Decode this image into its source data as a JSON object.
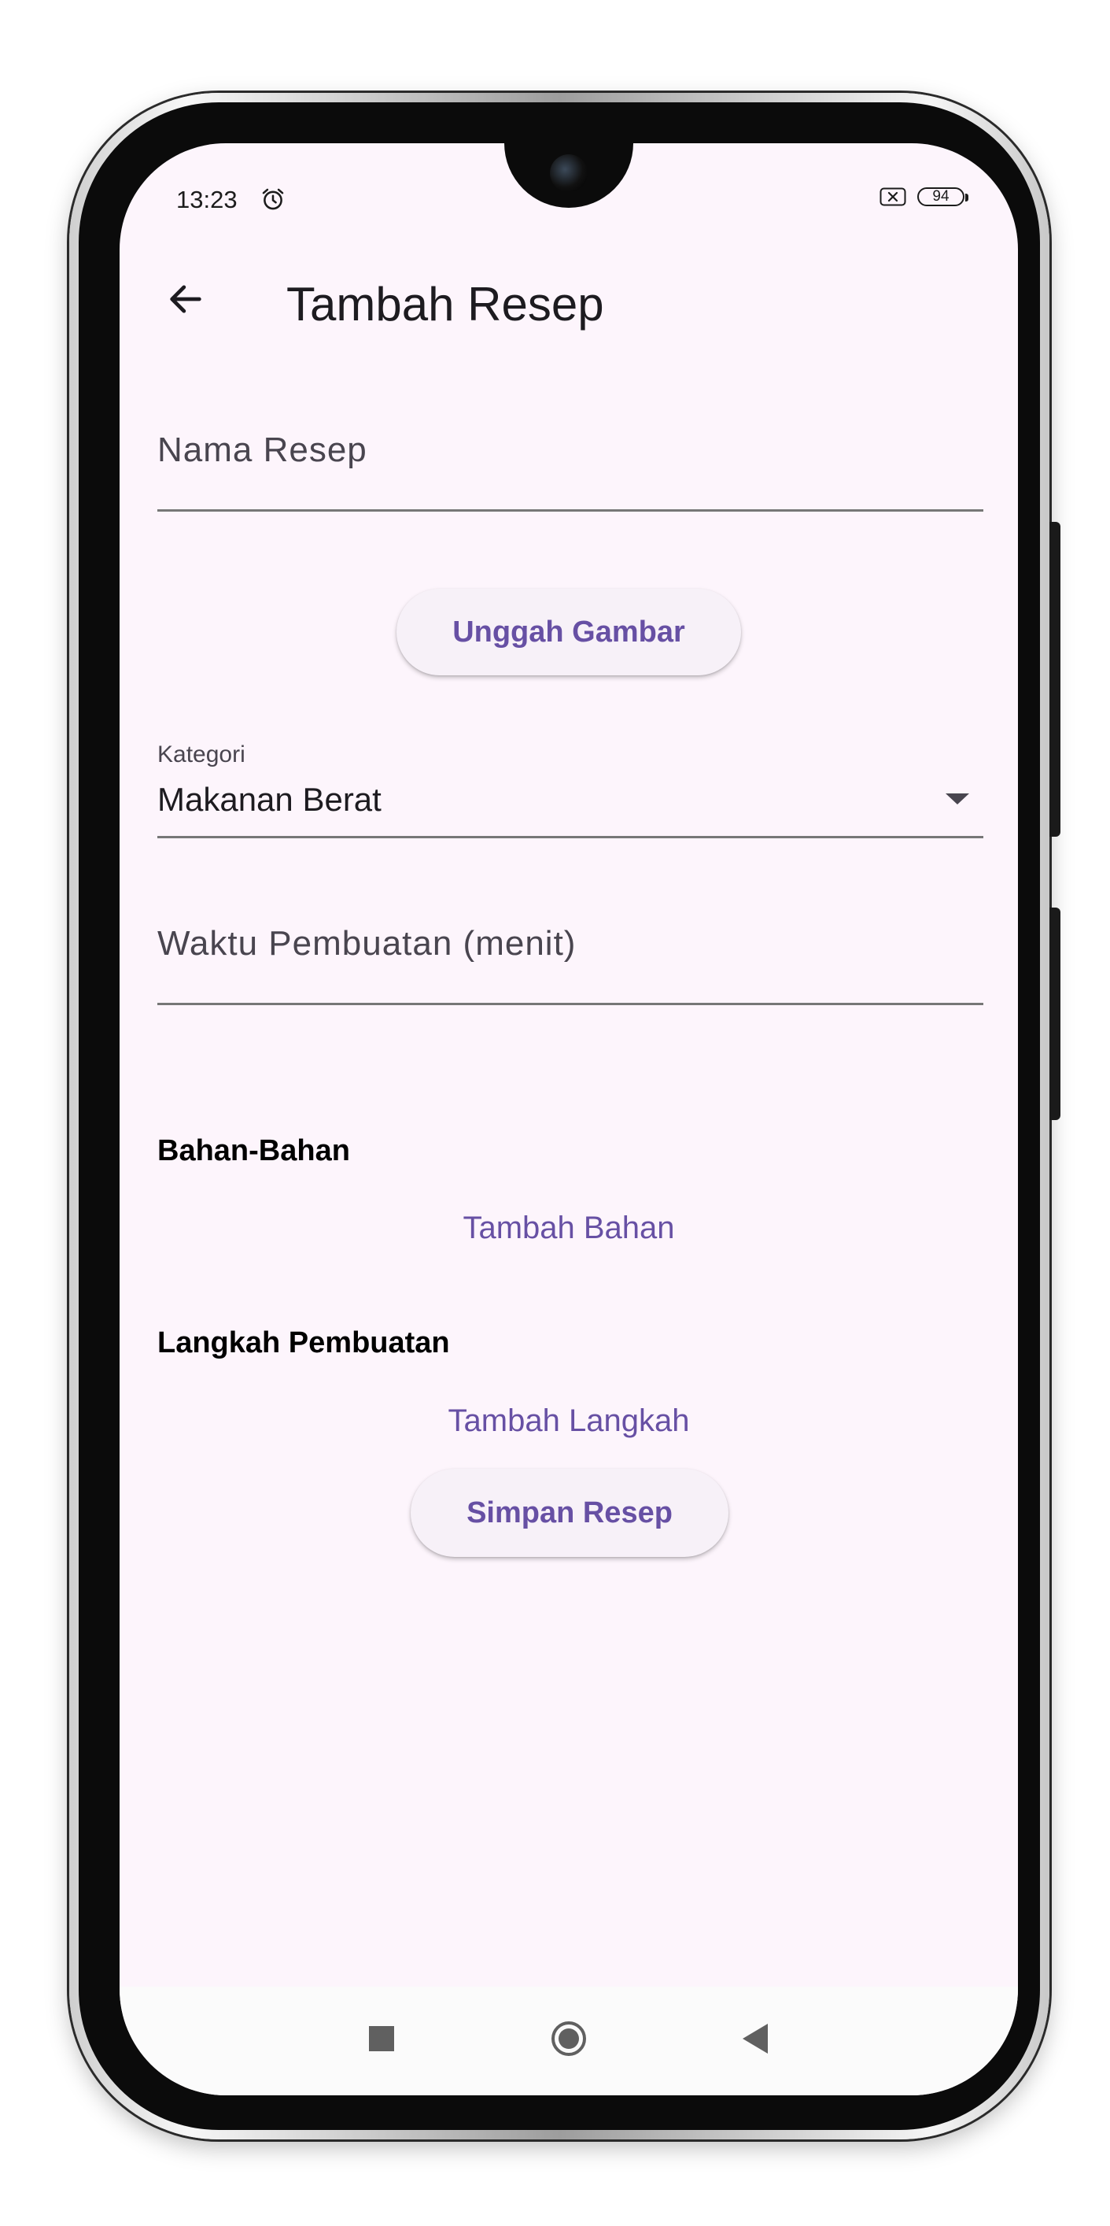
{
  "status_bar": {
    "time": "13:23",
    "battery_level": "94",
    "icons": [
      "alarm-icon",
      "sim-x-icon",
      "battery-icon"
    ]
  },
  "app_bar": {
    "title": "Tambah Resep",
    "back_icon": "arrow-back-icon"
  },
  "form": {
    "name_field": {
      "placeholder": "Nama Resep",
      "value": ""
    },
    "upload_button": "Unggah Gambar",
    "category": {
      "label": "Kategori",
      "selected": "Makanan Berat",
      "dropdown_icon": "arrow-drop-down-icon"
    },
    "time_field": {
      "placeholder": "Waktu Pembuatan (menit)",
      "value": ""
    },
    "ingredients": {
      "title": "Bahan-Bahan",
      "add_button": "Tambah Bahan"
    },
    "steps": {
      "title": "Langkah Pembuatan",
      "add_button": "Tambah Langkah"
    },
    "save_button": "Simpan Resep"
  },
  "nav_bar": {
    "icons": [
      "recents-square-icon",
      "home-circle-icon",
      "back-triangle-icon"
    ]
  },
  "colors": {
    "background": "#fdf5fc",
    "accent": "#6750a4",
    "text": "#1d1b20",
    "hint": "#49454f"
  }
}
